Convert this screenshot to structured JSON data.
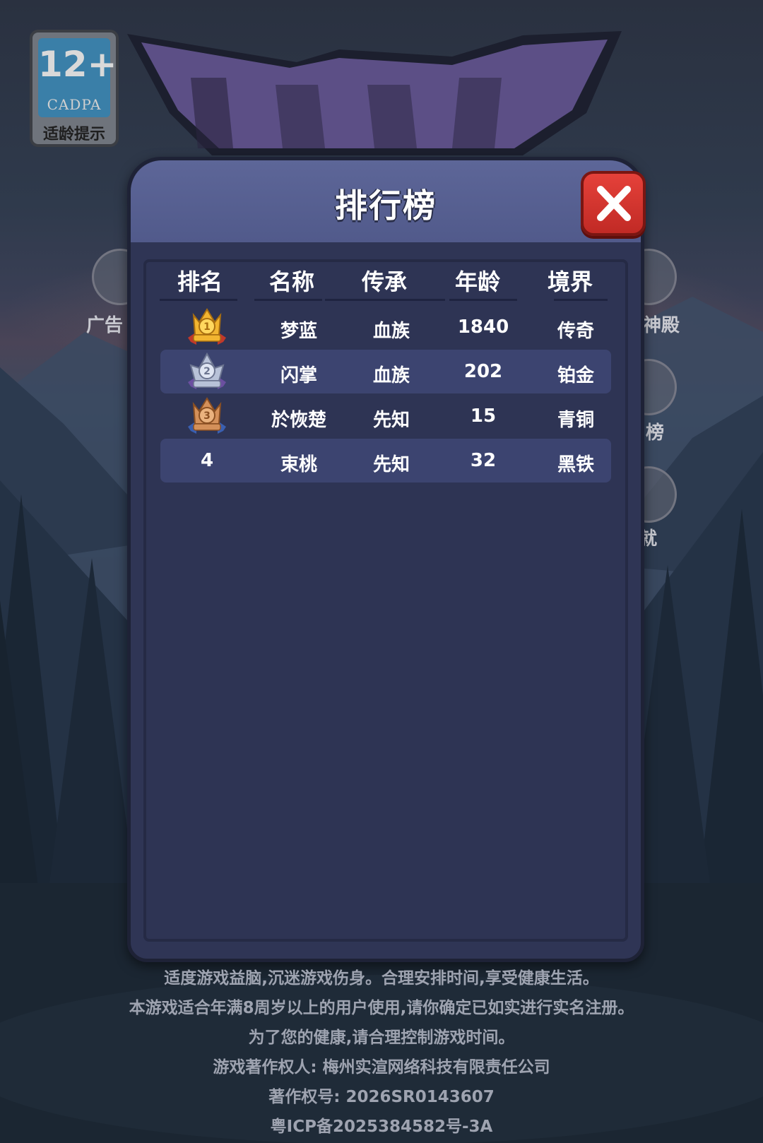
{
  "age_rating": {
    "age": "12+",
    "org": "CADPA",
    "tip": "适龄提示"
  },
  "side_buttons": {
    "left_label": "广告",
    "right_labels": [
      "神殿",
      "榜",
      "就"
    ]
  },
  "modal": {
    "title": "排行榜",
    "columns": [
      "排名",
      "名称",
      "传承",
      "年龄",
      "境界"
    ],
    "rows": [
      {
        "rank": "1",
        "name": "梦蓝",
        "lineage": "血族",
        "age": "1840",
        "realm": "传奇"
      },
      {
        "rank": "2",
        "name": "闪掌",
        "lineage": "血族",
        "age": "202",
        "realm": "铂金"
      },
      {
        "rank": "3",
        "name": "於恢楚",
        "lineage": "先知",
        "age": "15",
        "realm": "青铜"
      },
      {
        "rank": "4",
        "name": "束桃",
        "lineage": "先知",
        "age": "32",
        "realm": "黑铁"
      }
    ]
  },
  "footer": {
    "line1": "适度游戏益脑,沉迷游戏伤身。合理安排时间,享受健康生活。",
    "line2": "本游戏适合年满8周岁以上的用户使用,请你确定已如实进行实名注册。",
    "line3": "为了您的健康,请合理控制游戏时间。",
    "line4": "游戏著作权人: 梅州实渲网络科技有限责任公司",
    "line5": "著作权号: 2026SR0143607",
    "line6": "粤ICP备2025384582号-3A"
  },
  "colors": {
    "modal_header": "#5d6698",
    "modal_body": "#2e3454",
    "row_highlight": "#3c4470",
    "close_button": "#d8342e",
    "gold": "#f2b531",
    "silver": "#b8c2d8",
    "bronze": "#d4905a"
  }
}
